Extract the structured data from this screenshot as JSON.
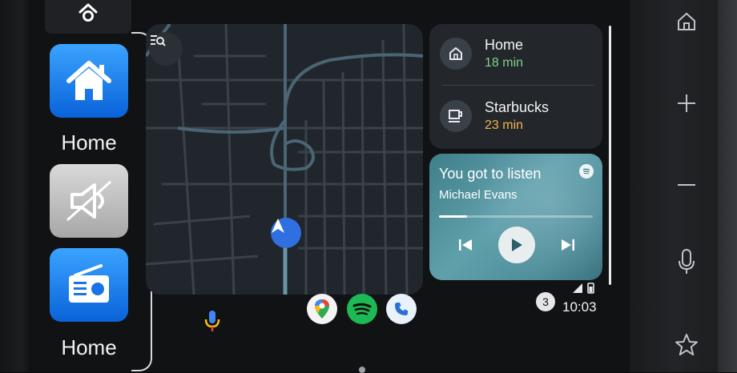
{
  "car_panel": {
    "apps": [
      {
        "label": "Home",
        "icon": "house-icon"
      },
      {
        "label": "",
        "icon": "speaker-icon"
      },
      {
        "label": "Home",
        "icon": "radio-icon"
      }
    ]
  },
  "destinations": [
    {
      "name": "Home",
      "time": "18 min",
      "icon": "home-icon",
      "time_color": "#7fd38a"
    },
    {
      "name": "Starbucks",
      "time": "23 min",
      "icon": "coffee-icon",
      "time_color": "#f0b34a"
    }
  ],
  "media": {
    "title": "You got to listen",
    "artist": "Michael Evans",
    "source_icon": "spotify-icon",
    "progress": 0.18
  },
  "dock": {
    "apps": [
      "microphone-icon",
      "google-maps-icon",
      "spotify-icon",
      "phone-icon"
    ]
  },
  "status": {
    "notification_count": "3",
    "time": "10:03"
  },
  "colors": {
    "accent_blue": "#2f6fe0",
    "spotify_green": "#1db954"
  }
}
